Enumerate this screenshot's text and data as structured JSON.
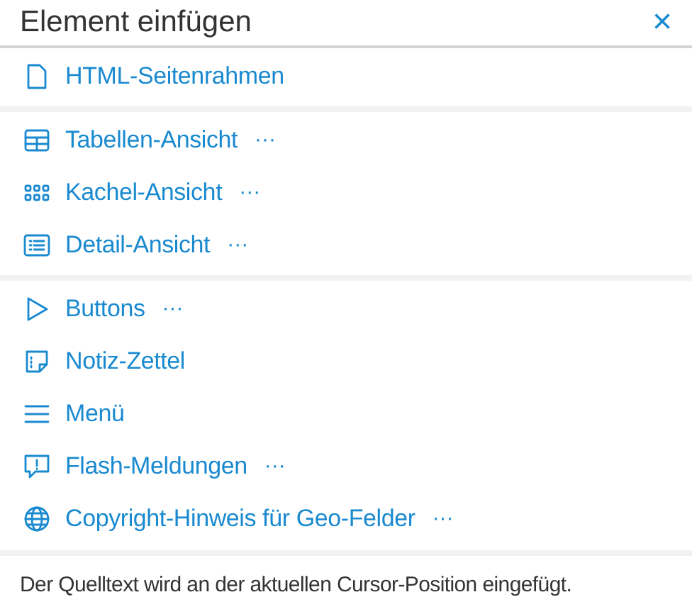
{
  "dialog": {
    "title": "Element einfügen",
    "close": "×"
  },
  "groups": [
    {
      "items": [
        {
          "label": "HTML-Seitenrahmen"
        }
      ]
    },
    {
      "items": [
        {
          "label": "Tabellen-Ansicht",
          "more": "···"
        },
        {
          "label": "Kachel-Ansicht",
          "more": "···"
        },
        {
          "label": "Detail-Ansicht",
          "more": "···"
        }
      ]
    },
    {
      "items": [
        {
          "label": "Buttons",
          "more": "···"
        },
        {
          "label": "Notiz-Zettel"
        },
        {
          "label": "Menü"
        },
        {
          "label": "Flash-Meldungen",
          "more": "···"
        },
        {
          "label": "Copyright-Hinweis für Geo-Felder",
          "more": "···"
        }
      ]
    }
  ],
  "footer": "Der Quelltext wird an der aktuellen Cursor-Position eingefügt."
}
